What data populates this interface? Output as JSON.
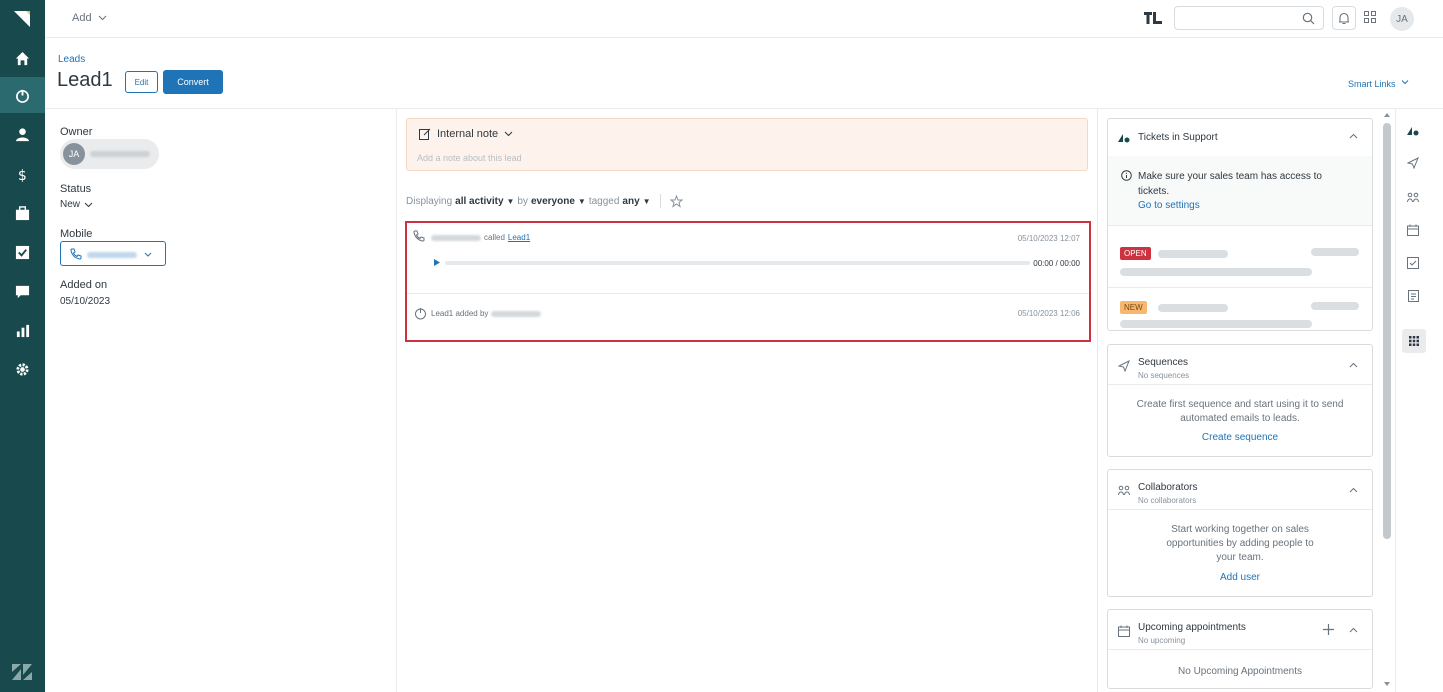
{
  "topbar": {
    "add_label": "Add",
    "user_initials": "JA"
  },
  "header": {
    "breadcrumb": "Leads",
    "title": "Lead1",
    "edit_label": "Edit",
    "convert_label": "Convert",
    "smart_links_label": "Smart Links"
  },
  "details": {
    "owner_label": "Owner",
    "owner_initials": "JA",
    "status_label": "Status",
    "status_value": "New",
    "mobile_label": "Mobile",
    "added_label": "Added on",
    "added_value": "05/10/2023"
  },
  "note": {
    "type_label": "Internal note",
    "placeholder": "Add a note about this lead"
  },
  "filter": {
    "displaying": "Displaying",
    "activity": "all activity",
    "by": "by",
    "who": "everyone",
    "tagged": "tagged",
    "tag": "any"
  },
  "activities": [
    {
      "verb": "called",
      "target": "Lead1",
      "timestamp": "05/10/2023 12:07",
      "audio_time": "00:00 / 00:00"
    },
    {
      "text": "Lead1 added by",
      "timestamp": "05/10/2023 12:06"
    }
  ],
  "tickets": {
    "title": "Tickets in Support",
    "info": "Make sure your sales team has access to tickets.",
    "settings_link": "Go to settings",
    "badges": [
      "OPEN",
      "NEW"
    ]
  },
  "sequences": {
    "title": "Sequences",
    "subtitle": "No sequences",
    "body": "Create first sequence and start using it to send automated emails to leads.",
    "link": "Create sequence"
  },
  "collaborators": {
    "title": "Collaborators",
    "subtitle": "No collaborators",
    "body": "Start working together on sales opportunities by adding people to your team.",
    "link": "Add user"
  },
  "appointments": {
    "title": "Upcoming appointments",
    "subtitle": "No upcoming",
    "body": "No Upcoming Appointments"
  },
  "colors": {
    "nav": "#17494d",
    "primary": "#1f73b7",
    "open_badge": "#cc3340",
    "new_badge": "#f8b76f",
    "highlight_border": "#cc3340"
  }
}
